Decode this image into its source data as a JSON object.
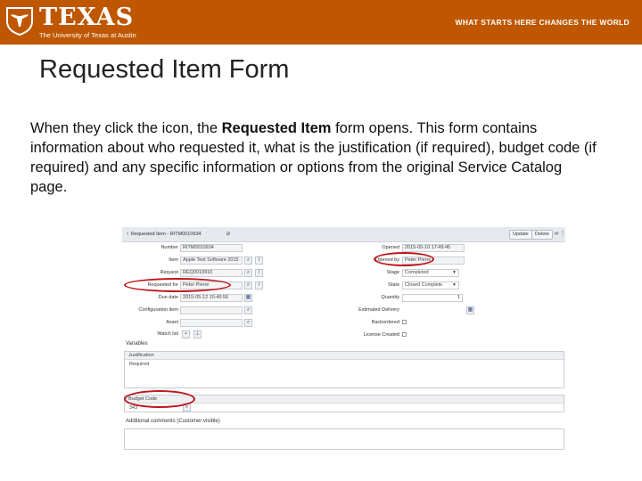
{
  "banner": {
    "wordmark": "TEXAS",
    "university": "The University of Texas at Austin",
    "tagline": "WHAT STARTS HERE CHANGES THE WORLD",
    "color": "#bf5700"
  },
  "slide": {
    "title": "Requested Item Form",
    "body_before": "When they click the icon, the ",
    "body_bold": "Requested Item",
    "body_after": " form opens. This form contains information about who requested it, what is the justification (if required), budget code (if required) and any specific information or options from the original Service Catalog page."
  },
  "form": {
    "header_title": "Requested Item - RITM0010934",
    "buttons": {
      "update": "Update",
      "delete": "Delete"
    },
    "left_fields": [
      {
        "label": "Number",
        "value": "RITM0010934"
      },
      {
        "label": "Item",
        "value": "Apple Test Software 2015"
      },
      {
        "label": "Request",
        "value": "REQ0010910"
      },
      {
        "label": "Requested for",
        "value": "Peter Pierre"
      },
      {
        "label": "Due date",
        "value": "2015-05-12 15:46:56"
      },
      {
        "label": "Configuration item",
        "value": ""
      },
      {
        "label": "Asset",
        "value": ""
      },
      {
        "label": "Watch list",
        "value": ""
      }
    ],
    "right_fields": [
      {
        "label": "Opened",
        "value": "2015-05-10 17:49:45"
      },
      {
        "label": "Opened by",
        "value": "Peter Pierre"
      },
      {
        "label": "Stage",
        "value": "Completed"
      },
      {
        "label": "State",
        "value": "Closed Complete"
      },
      {
        "label": "Quantity",
        "value": "1"
      },
      {
        "label": "Estimated Delivery",
        "value": ""
      },
      {
        "label": "Backordered",
        "value": ""
      },
      {
        "label": "License Created",
        "value": ""
      }
    ],
    "variables_label": "Variables",
    "justification": {
      "label": "Justification",
      "value": "Required"
    },
    "budget_code": {
      "label": "Budget Code",
      "value": "343"
    },
    "additional_comments_label": "Additional comments (Customer visible)",
    "highlight_color": "#c0161c"
  }
}
